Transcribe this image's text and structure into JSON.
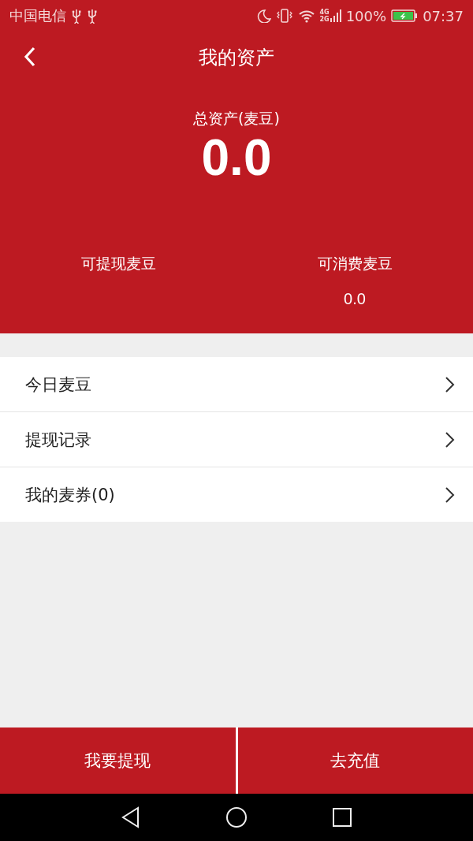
{
  "status_bar": {
    "carrier": "中国电信",
    "network": [
      "4G",
      "2G"
    ],
    "battery_percent": "100%",
    "time": "07:37"
  },
  "header": {
    "title": "我的资产",
    "total_label": "总资产(麦豆)",
    "total_value": "0.0",
    "balances": [
      {
        "label": "可提现麦豆"
      },
      {
        "label": "可消费麦豆",
        "value": "0.0"
      }
    ]
  },
  "menu": [
    {
      "label": "今日麦豆"
    },
    {
      "label": "提现记录"
    },
    {
      "label": "我的麦券(0)"
    }
  ],
  "actions": [
    {
      "label": "我要提现"
    },
    {
      "label": "去充值"
    }
  ]
}
